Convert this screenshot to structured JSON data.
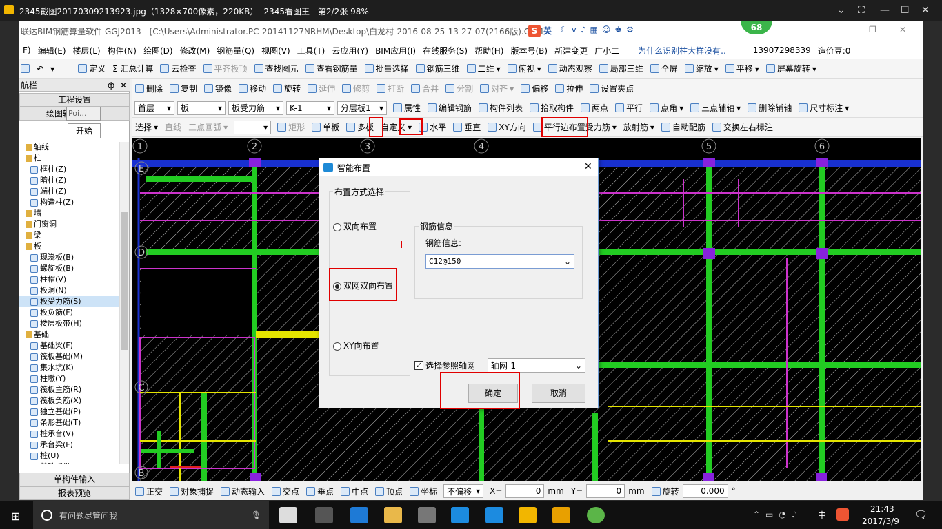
{
  "viewer": {
    "title": "2345截图20170309213923.jpg（1328×700像素，220KB）- 2345看图王 - 第2/2张 98%"
  },
  "app": {
    "title": "联达BIM钢筋算量软件 GGJ2013 - [C:\\Users\\Administrator.PC-20141127NRHM\\Desktop\\白龙村-2016-08-25-13-27-07(2166版).GGJ1",
    "ime": {
      "label": "英",
      "badge": "68"
    },
    "menu": [
      "F)",
      "编辑(E)",
      "楼层(L)",
      "构件(N)",
      "绘图(D)",
      "修改(M)",
      "钢筋量(Q)",
      "视图(V)",
      "工具(T)",
      "云应用(Y)",
      "BIM应用(I)",
      "在线服务(S)",
      "帮助(H)",
      "版本号(B)",
      "新建变更",
      "广小二"
    ],
    "menu_right": {
      "ask": "为什么识别柱大样没有..",
      "phone": "13907298339",
      "beans": "造价豆:0"
    },
    "toolbar1": [
      "定义",
      "Σ 汇总计算",
      "云检查",
      "平齐板顶",
      "查找图元",
      "查看钢筋量",
      "批量选择",
      "钢筋三维",
      "二维",
      "俯视",
      "动态观察",
      "局部三维",
      "全屏",
      "缩放",
      "平移",
      "屏幕旋转"
    ],
    "toolbar2": [
      "删除",
      "复制",
      "镜像",
      "移动",
      "旋转",
      "延伸",
      "修剪",
      "打断",
      "合并",
      "分割",
      "对齐",
      "偏移",
      "拉伸",
      "设置夹点"
    ],
    "toolbar3": {
      "floor": "首层",
      "type": "板",
      "sub": "板受力筋",
      "name": "K-1",
      "layer": "分层板1",
      "items": [
        "属性",
        "编辑钢筋",
        "构件列表",
        "拾取构件",
        "两点",
        "平行",
        "点角",
        "三点辅轴",
        "删除辅轴",
        "尺寸标注"
      ]
    },
    "toolbar4": [
      "选择",
      "直线",
      "三点画弧",
      "矩形",
      "单板",
      "多板",
      "自定义",
      "水平",
      "垂直",
      "XY方向",
      "平行边布置受力筋",
      "放射筋",
      "自动配筋",
      "交换左右标注"
    ],
    "sidebar": {
      "title": "航栏",
      "pin": "ф",
      "close": "✕",
      "btn1": "工程设置",
      "btn2": "绘图输",
      "popup": "Poi...",
      "popup_btn": "开始",
      "tree": [
        {
          "t": "轴线",
          "lvl": 1
        },
        {
          "t": "柱",
          "lvl": 1
        },
        {
          "t": "框柱(Z)",
          "lvl": 2
        },
        {
          "t": "暗柱(Z)",
          "lvl": 2
        },
        {
          "t": "端柱(Z)",
          "lvl": 2
        },
        {
          "t": "构造柱(Z)",
          "lvl": 2
        },
        {
          "t": "墙",
          "lvl": 1
        },
        {
          "t": "门窗洞",
          "lvl": 1
        },
        {
          "t": "梁",
          "lvl": 1
        },
        {
          "t": "板",
          "lvl": 1
        },
        {
          "t": "现浇板(B)",
          "lvl": 2
        },
        {
          "t": "螺旋板(B)",
          "lvl": 2
        },
        {
          "t": "柱帽(V)",
          "lvl": 2
        },
        {
          "t": "板洞(N)",
          "lvl": 2
        },
        {
          "t": "板受力筋(S)",
          "lvl": 2
        },
        {
          "t": "板负筋(F)",
          "lvl": 2
        },
        {
          "t": "楼层板带(H)",
          "lvl": 2
        },
        {
          "t": "基础",
          "lvl": 1
        },
        {
          "t": "基础梁(F)",
          "lvl": 2
        },
        {
          "t": "筏板基础(M)",
          "lvl": 2
        },
        {
          "t": "集水坑(K)",
          "lvl": 2
        },
        {
          "t": "柱墩(Y)",
          "lvl": 2
        },
        {
          "t": "筏板主筋(R)",
          "lvl": 2
        },
        {
          "t": "筏板负筋(X)",
          "lvl": 2
        },
        {
          "t": "独立基础(P)",
          "lvl": 2
        },
        {
          "t": "条形基础(T)",
          "lvl": 2
        },
        {
          "t": "桩承台(V)",
          "lvl": 2
        },
        {
          "t": "承台梁(F)",
          "lvl": 2
        },
        {
          "t": "桩(U)",
          "lvl": 2
        },
        {
          "t": "基础板带(W)",
          "lvl": 2
        }
      ],
      "bottom1": "单构件输入",
      "bottom2": "报表预览"
    },
    "axes": [
      "1",
      "2",
      "3",
      "4",
      "5",
      "6"
    ],
    "axis_rows": [
      "E",
      "D",
      "C",
      "B"
    ],
    "status": {
      "items": [
        "正交",
        "对象捕捉",
        "动态输入",
        "交点",
        "垂点",
        "中点",
        "顶点",
        "坐标"
      ],
      "offset": "不偏移",
      "x_label": "X=",
      "x": "0",
      "mm1": "mm",
      "y_label": "Y=",
      "y": "0",
      "mm2": "mm",
      "rot_label": "旋转",
      "rot": "0.000",
      "deg": "°"
    }
  },
  "dialog": {
    "title": "智能布置",
    "group": "布置方式选择",
    "opt1": "双向布置",
    "opt2": "双网双向布置",
    "opt3": "XY向布置",
    "rebar_group": "钢筋信息",
    "rebar_label": "钢筋信息:",
    "rebar_value": "C12@150",
    "ref_label": "选择参照轴网",
    "ref_value": "轴网-1",
    "ok": "确定",
    "cancel": "取消",
    "close": "✕"
  },
  "taskbar": {
    "search": "有问题尽管问我",
    "ime": "中",
    "time": "21:43",
    "date": "2017/3/9"
  }
}
